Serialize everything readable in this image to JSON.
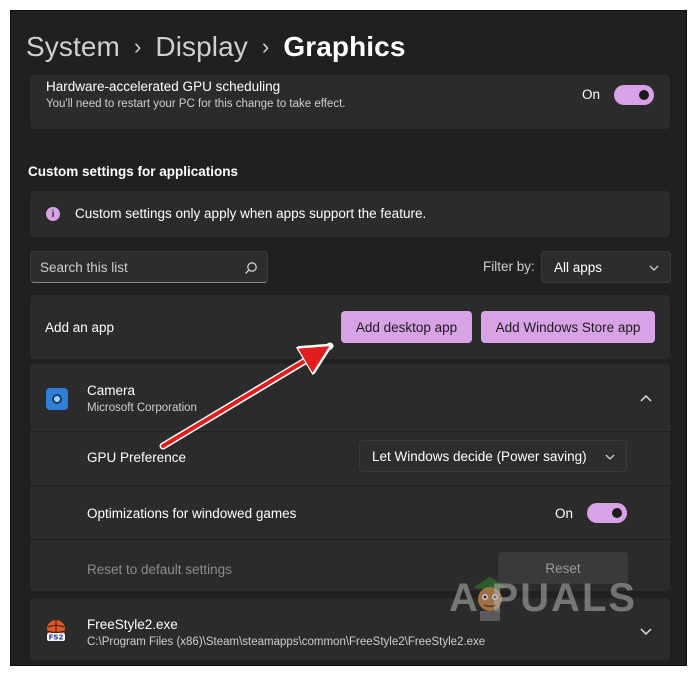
{
  "breadcrumb": {
    "items": [
      "System",
      "Display"
    ],
    "current": "Graphics",
    "separator": "›"
  },
  "gpu_scheduling": {
    "title": "Hardware-accelerated GPU scheduling",
    "description": "You'll need to restart your PC for this change to take effect.",
    "toggle_label": "On",
    "enabled": true
  },
  "custom_settings": {
    "section_title": "Custom settings for applications",
    "info_text": "Custom settings only apply when apps support the feature.",
    "info_icon": "info-icon"
  },
  "search": {
    "placeholder": "Search this list",
    "icon": "search-icon"
  },
  "filter": {
    "label": "Filter by:",
    "selected": "All apps"
  },
  "add_app": {
    "label": "Add an app",
    "desktop_button": "Add desktop app",
    "store_button": "Add Windows Store app"
  },
  "apps": [
    {
      "name": "Camera",
      "subtitle": "Microsoft Corporation",
      "icon": "camera-icon",
      "expanded": true,
      "gpu_preference_label": "GPU Preference",
      "gpu_preference_value": "Let Windows decide (Power saving)",
      "windowed_label": "Optimizations for windowed games",
      "windowed_toggle_label": "On",
      "windowed_enabled": true,
      "reset_label": "Reset to default settings",
      "reset_button": "Reset"
    },
    {
      "name": "FreeStyle2.exe",
      "subtitle": "C:\\Program Files (x86)\\Steam\\steamapps\\common\\FreeStyle2\\FreeStyle2.exe",
      "icon": "freestyle2-icon",
      "expanded": false
    }
  ],
  "watermark": "A  PUALS",
  "colors": {
    "background": "#202020",
    "card": "#2b2b2b",
    "accent": "#d7a3e6",
    "annotation_arrow": "#e11d1d"
  }
}
